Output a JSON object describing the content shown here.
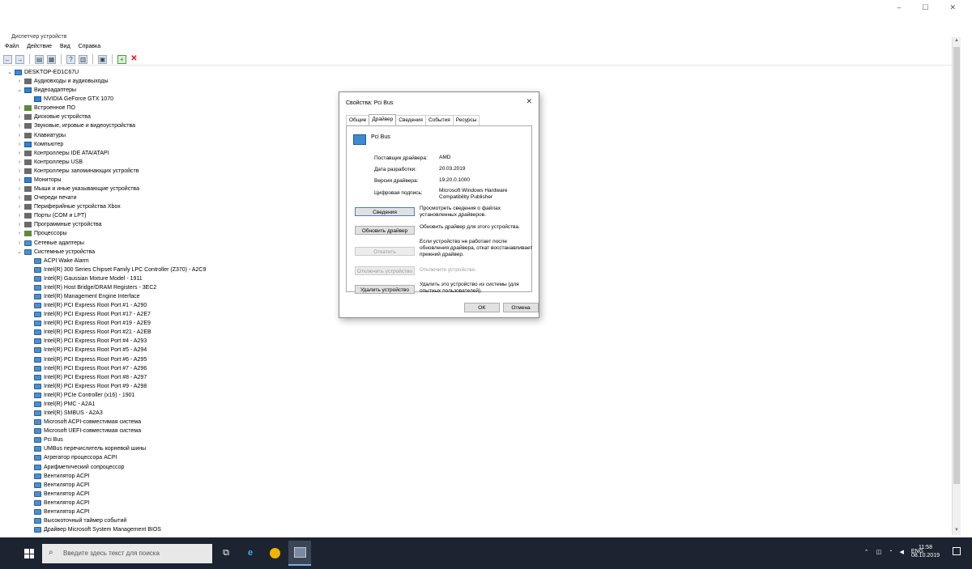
{
  "window": {
    "title": "Диспетчер устройств",
    "controls": {
      "minimize": "–",
      "maximize": "☐",
      "close": "✕"
    },
    "menu": [
      "Файл",
      "Действие",
      "Вид",
      "Справка"
    ]
  },
  "toolbar": {
    "back": "←",
    "forward": "→",
    "view": "▤",
    "props": "▦",
    "help": "?",
    "panel": "▥",
    "monitor": "▣",
    "add": "+",
    "remove": "✕"
  },
  "tree": {
    "root": "DESKTOP-ED1C67U",
    "categories": [
      {
        "label": "Аудиовходы и аудиовыходы",
        "icon": "speaker-icon",
        "expanded": false
      },
      {
        "label": "Видеоадаптеры",
        "icon": "monitor-icon",
        "expanded": true
      },
      {
        "label": "Встроенное ПО",
        "icon": "chip-icon",
        "expanded": false
      },
      {
        "label": "Дисковые устройства",
        "icon": "disk-icon",
        "expanded": false
      },
      {
        "label": "Звуковые, игровые и видеоустройства",
        "icon": "speaker-icon",
        "expanded": false
      },
      {
        "label": "Клавиатуры",
        "icon": "keyboard-icon",
        "expanded": false
      },
      {
        "label": "Компьютер",
        "icon": "computer-icon",
        "expanded": false
      },
      {
        "label": "Контроллеры IDE ATA/ATAPI",
        "icon": "controller-icon",
        "expanded": false
      },
      {
        "label": "Контроллеры USB",
        "icon": "usb-icon",
        "expanded": false
      },
      {
        "label": "Контроллеры запоминающих устройств",
        "icon": "storage-icon",
        "expanded": false
      },
      {
        "label": "Мониторы",
        "icon": "monitor-icon",
        "expanded": false
      },
      {
        "label": "Мыши и иные указывающие устройства",
        "icon": "mouse-icon",
        "expanded": false
      },
      {
        "label": "Очереди печати",
        "icon": "printer-icon",
        "expanded": false
      },
      {
        "label": "Периферийные устройства Xbox",
        "icon": "gamepad-icon",
        "expanded": false
      },
      {
        "label": "Порты (COM и LPT)",
        "icon": "port-icon",
        "expanded": false
      },
      {
        "label": "Программные устройства",
        "icon": "software-icon",
        "expanded": false
      },
      {
        "label": "Процессоры",
        "icon": "cpu-icon",
        "expanded": false
      },
      {
        "label": "Сетевые адаптеры",
        "icon": "network-icon",
        "expanded": false
      },
      {
        "label": "Системные устройства",
        "icon": "system-icon",
        "expanded": true
      }
    ],
    "video_children": [
      "NVIDIA GeForce GTX 1070"
    ],
    "system_children": [
      "ACPI Wake Alarm",
      "Intel(R) 300 Series Chipset Family LPC Controller (Z370) - A2C9",
      "Intel(R) Gaussian Mixture Model - 1911",
      "Intel(R) Host Bridge/DRAM Registers - 3EC2",
      "Intel(R) Management Engine Interface",
      "Intel(R) PCI Express Root Port #1 - A290",
      "Intel(R) PCI Express Root Port #17 - A2E7",
      "Intel(R) PCI Express Root Port #19 - A2E9",
      "Intel(R) PCI Express Root Port #21 - A2EB",
      "Intel(R) PCI Express Root Port #4 - A293",
      "Intel(R) PCI Express Root Port #5 - A294",
      "Intel(R) PCI Express Root Port #6 - A295",
      "Intel(R) PCI Express Root Port #7 - A296",
      "Intel(R) PCI Express Root Port #8 - A297",
      "Intel(R) PCI Express Root Port #9 - A298",
      "Intel(R) PCIe Controller (x16) - 1901",
      "Intel(R) PMC - A2A1",
      "Intel(R) SMBUS - A2A3",
      "Microsoft ACPI-совместимая система",
      "Microsoft UEFI-совместимая система",
      "Pci Bus",
      "UMBus перечислитель корневой шины",
      "Агрегатор процессора ACPI",
      "Арифметический сопроцессор",
      "Вентилятор ACPI",
      "Вентилятор ACPI",
      "Вентилятор ACPI",
      "Вентилятор ACPI",
      "Вентилятор ACPI",
      "Высокоточный таймер событий",
      "Драйвер Microsoft System Management BIOS"
    ]
  },
  "dialog": {
    "title": "Свойства: Pci Bus",
    "close": "✕",
    "tabs": [
      "Общие",
      "Драйвер",
      "Сведения",
      "События",
      "Ресурсы"
    ],
    "active_tab": "Драйвер",
    "device_name": "Pci Bus",
    "props": [
      {
        "label": "Поставщик драйвера:",
        "value": "AMD"
      },
      {
        "label": "Дата разработки:",
        "value": "20.03.2019"
      },
      {
        "label": "Версия драйвера:",
        "value": "19.20.0.1000"
      },
      {
        "label": "Цифровая подпись:",
        "value": "Microsoft Windows Hardware Compatibility Publisher"
      }
    ],
    "actions": [
      {
        "button": "Сведения",
        "desc": "Просмотреть сведения о файлах установленных драйверов.",
        "disabled": false
      },
      {
        "button": "Обновить драйвер",
        "desc": "Обновить драйвер для этого устройства.",
        "disabled": false
      },
      {
        "button": "Откатить",
        "desc": "Если устройство не работает после обновления драйвера, откат восстанавливает прежний драйвер.",
        "disabled": true
      },
      {
        "button": "Отключить устройство",
        "desc": "Отключите устройство.",
        "disabled": true
      },
      {
        "button": "Удалить устройство",
        "desc": "Удалить это устройство из системы (для опытных пользователей).",
        "disabled": false
      }
    ],
    "ok": "OK",
    "cancel": "Отмена"
  },
  "taskbar": {
    "search_placeholder": "Введите здесь текст для поиска",
    "lang": "ENG",
    "time": "11:58",
    "date": "08.10.2019"
  }
}
